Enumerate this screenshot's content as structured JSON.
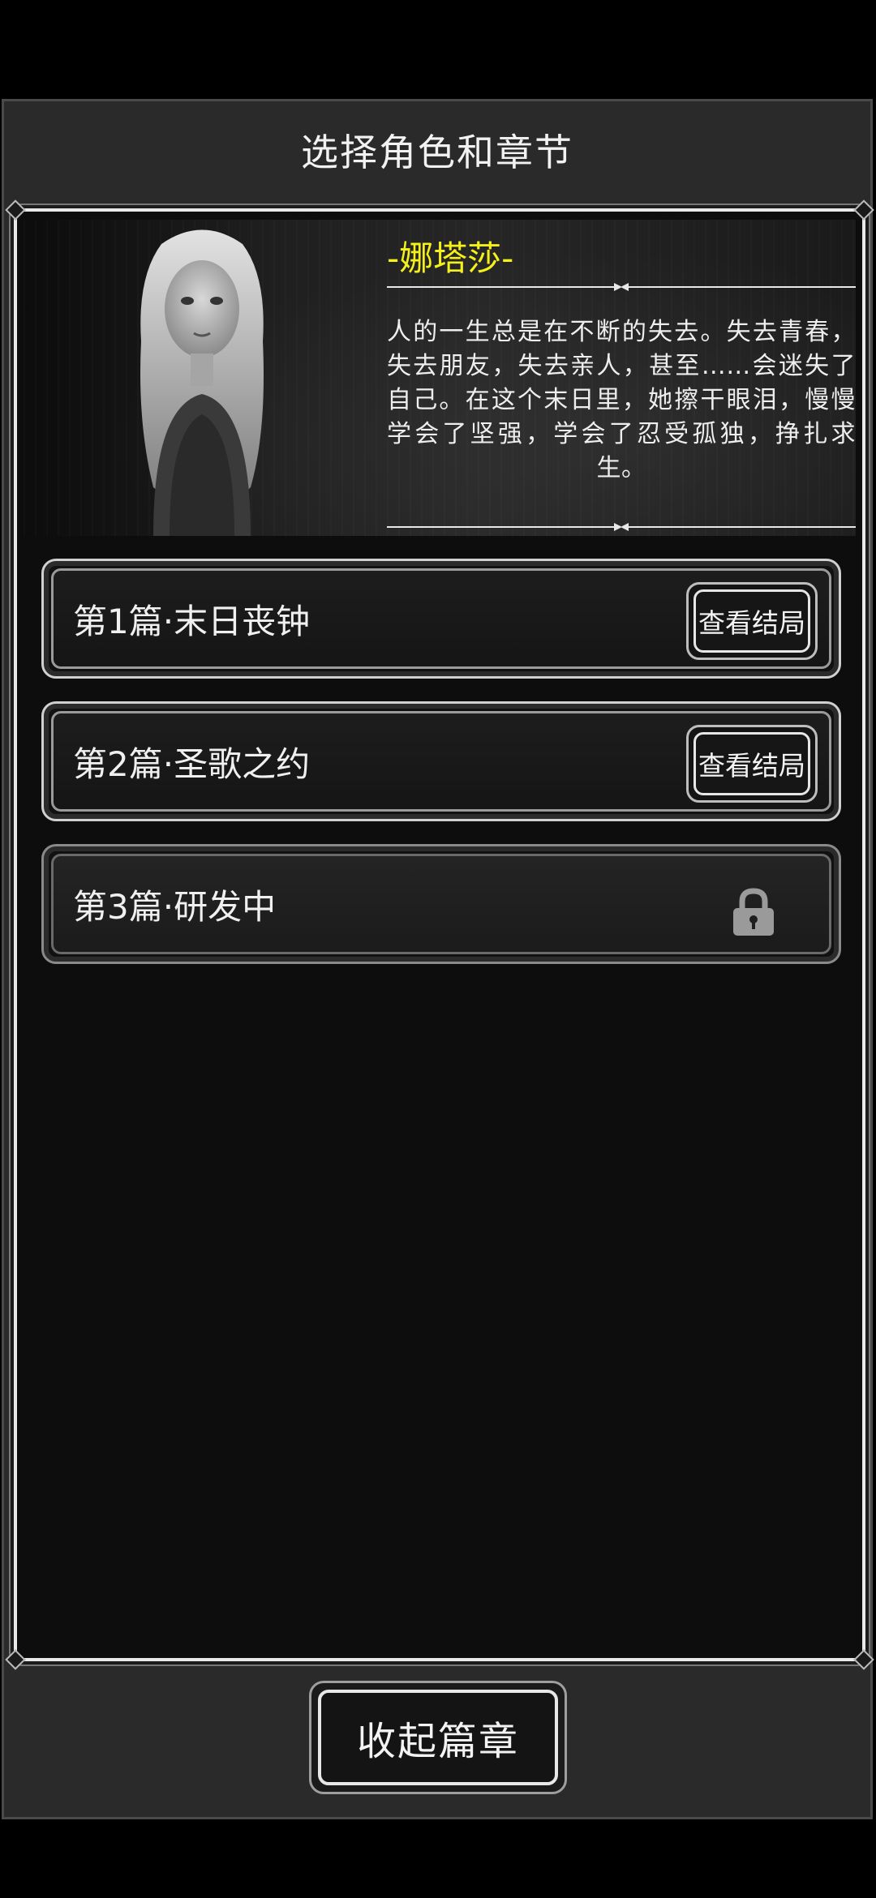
{
  "screen_title": "选择角色和章节",
  "character": {
    "name": "-娜塔莎-",
    "description": "人的一生总是在不断的失去。失去青春，失去朋友，失去亲人，甚至……会迷失了自己。在这个末日里，她擦干眼泪，慢慢学会了坚强，学会了忍受孤独，挣扎求生。",
    "name_color": "#f5ef1a"
  },
  "chapters": [
    {
      "title": "第1篇·末日丧钟",
      "action_label": "查看结局",
      "locked": false
    },
    {
      "title": "第2篇·圣歌之约",
      "action_label": "查看结局",
      "locked": false
    },
    {
      "title": "第3篇·研发中",
      "action_label": "",
      "locked": true,
      "icon": "lock-icon"
    }
  ],
  "collapse_button": {
    "label": "收起篇章"
  }
}
